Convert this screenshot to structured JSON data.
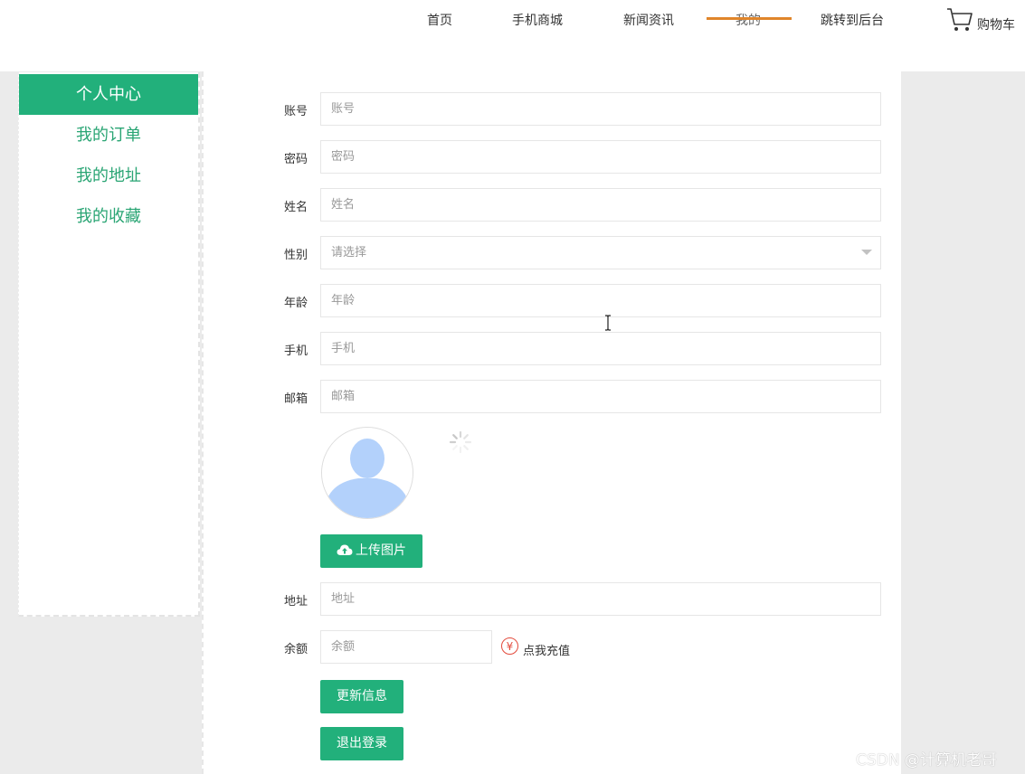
{
  "nav": {
    "items": [
      "首页",
      "手机商城",
      "新闻资讯",
      "我的",
      "跳转到后台"
    ],
    "active": "我的",
    "cart_label": "购物车"
  },
  "sidebar": {
    "items": [
      "个人中心",
      "我的订单",
      "我的地址",
      "我的收藏"
    ],
    "active": "个人中心"
  },
  "form": {
    "account": {
      "label": "账号",
      "placeholder": "账号"
    },
    "password": {
      "label": "密码",
      "placeholder": "密码"
    },
    "name": {
      "label": "姓名",
      "placeholder": "姓名"
    },
    "gender": {
      "label": "性别",
      "placeholder": "请选择"
    },
    "age": {
      "label": "年龄",
      "placeholder": "年龄"
    },
    "phone": {
      "label": "手机",
      "placeholder": "手机"
    },
    "email": {
      "label": "邮箱",
      "placeholder": "邮箱"
    },
    "upload_button": "上传图片",
    "address": {
      "label": "地址",
      "placeholder": "地址"
    },
    "balance": {
      "label": "余额",
      "placeholder": "余额"
    },
    "recharge_icon": "¥",
    "recharge_label": "点我充值",
    "update_button": "更新信息",
    "logout_button": "退出登录"
  },
  "watermark": "CSDN @计算机老哥",
  "colors": {
    "accent": "#22b07b",
    "nav_underline": "#e0852a",
    "recharge": "#e34a3c"
  },
  "icons": [
    "cart-icon",
    "avatar-placeholder-icon",
    "loading-spinner-icon",
    "cloud-upload-icon",
    "yuan-icon",
    "dropdown-arrow-icon",
    "text-cursor-icon"
  ]
}
